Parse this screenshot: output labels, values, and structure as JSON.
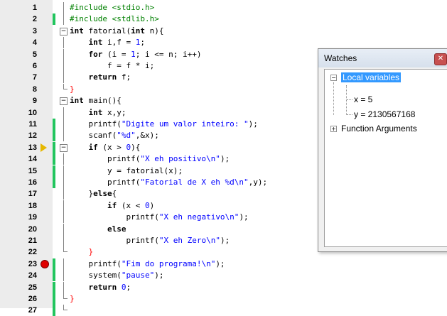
{
  "editor": {
    "lines": [
      {
        "no": "1",
        "tokens": [
          {
            "t": "#include <stdio.h>",
            "c": "pp"
          }
        ]
      },
      {
        "no": "2",
        "tokens": [
          {
            "t": "#include <stdlib.h>",
            "c": "pp"
          }
        ]
      },
      {
        "no": "3",
        "tokens": [
          {
            "t": "int",
            "c": "kw"
          },
          {
            "t": " fatorial(",
            "c": ""
          },
          {
            "t": "int",
            "c": "kw"
          },
          {
            "t": " n){",
            "c": ""
          }
        ]
      },
      {
        "no": "4",
        "tokens": [
          {
            "t": "    ",
            "c": ""
          },
          {
            "t": "int",
            "c": "kw"
          },
          {
            "t": " i,f = ",
            "c": ""
          },
          {
            "t": "1",
            "c": "num"
          },
          {
            "t": ";",
            "c": ""
          }
        ]
      },
      {
        "no": "5",
        "tokens": [
          {
            "t": "    ",
            "c": ""
          },
          {
            "t": "for",
            "c": "kw"
          },
          {
            "t": " (i = ",
            "c": ""
          },
          {
            "t": "1",
            "c": "num"
          },
          {
            "t": "; i <= n; i++)",
            "c": ""
          }
        ]
      },
      {
        "no": "6",
        "tokens": [
          {
            "t": "        f = f * i;",
            "c": ""
          }
        ]
      },
      {
        "no": "7",
        "tokens": [
          {
            "t": "    ",
            "c": ""
          },
          {
            "t": "return",
            "c": "kw"
          },
          {
            "t": " f;",
            "c": ""
          }
        ]
      },
      {
        "no": "8",
        "tokens": [
          {
            "t": "}",
            "c": "sym"
          }
        ]
      },
      {
        "no": "9",
        "tokens": [
          {
            "t": "int",
            "c": "kw"
          },
          {
            "t": " main(){",
            "c": ""
          }
        ]
      },
      {
        "no": "10",
        "tokens": [
          {
            "t": "    ",
            "c": ""
          },
          {
            "t": "int",
            "c": "kw"
          },
          {
            "t": " x,y;",
            "c": ""
          }
        ]
      },
      {
        "no": "11",
        "tokens": [
          {
            "t": "    printf(",
            "c": ""
          },
          {
            "t": "\"Digite um valor inteiro: \"",
            "c": "str"
          },
          {
            "t": ");",
            "c": ""
          }
        ]
      },
      {
        "no": "12",
        "tokens": [
          {
            "t": "    scanf(",
            "c": ""
          },
          {
            "t": "\"%d\"",
            "c": "str"
          },
          {
            "t": ",&x);",
            "c": ""
          }
        ]
      },
      {
        "no": "13",
        "tokens": [
          {
            "t": "    ",
            "c": ""
          },
          {
            "t": "if",
            "c": "kw"
          },
          {
            "t": " (x > ",
            "c": ""
          },
          {
            "t": "0",
            "c": "num"
          },
          {
            "t": "){",
            "c": ""
          }
        ]
      },
      {
        "no": "14",
        "tokens": [
          {
            "t": "        printf(",
            "c": ""
          },
          {
            "t": "\"X eh positivo\\n\"",
            "c": "str"
          },
          {
            "t": ");",
            "c": ""
          }
        ]
      },
      {
        "no": "15",
        "tokens": [
          {
            "t": "        y = fatorial(x);",
            "c": ""
          }
        ]
      },
      {
        "no": "16",
        "tokens": [
          {
            "t": "        printf(",
            "c": ""
          },
          {
            "t": "\"Fatorial de X eh %d\\n\"",
            "c": "str"
          },
          {
            "t": ",y);",
            "c": ""
          }
        ]
      },
      {
        "no": "17",
        "tokens": [
          {
            "t": "    }",
            "c": ""
          },
          {
            "t": "else",
            "c": "kw"
          },
          {
            "t": "{",
            "c": ""
          }
        ]
      },
      {
        "no": "18",
        "tokens": [
          {
            "t": "        ",
            "c": ""
          },
          {
            "t": "if",
            "c": "kw"
          },
          {
            "t": " (x < ",
            "c": ""
          },
          {
            "t": "0",
            "c": "num"
          },
          {
            "t": ")",
            "c": ""
          }
        ]
      },
      {
        "no": "19",
        "tokens": [
          {
            "t": "            printf(",
            "c": ""
          },
          {
            "t": "\"X eh negativo\\n\"",
            "c": "str"
          },
          {
            "t": ");",
            "c": ""
          }
        ]
      },
      {
        "no": "20",
        "tokens": [
          {
            "t": "        ",
            "c": ""
          },
          {
            "t": "else",
            "c": "kw"
          }
        ]
      },
      {
        "no": "21",
        "tokens": [
          {
            "t": "            printf(",
            "c": ""
          },
          {
            "t": "\"X eh Zero\\n\"",
            "c": "str"
          },
          {
            "t": ");",
            "c": ""
          }
        ]
      },
      {
        "no": "22",
        "tokens": [
          {
            "t": "    }",
            "c": "sym"
          }
        ]
      },
      {
        "no": "23",
        "tokens": [
          {
            "t": "    printf(",
            "c": ""
          },
          {
            "t": "\"Fim do programa!\\n\"",
            "c": "str"
          },
          {
            "t": ");",
            "c": ""
          }
        ]
      },
      {
        "no": "24",
        "tokens": [
          {
            "t": "    system(",
            "c": ""
          },
          {
            "t": "\"pause\"",
            "c": "str"
          },
          {
            "t": ");",
            "c": ""
          }
        ]
      },
      {
        "no": "25",
        "tokens": [
          {
            "t": "    ",
            "c": ""
          },
          {
            "t": "return",
            "c": "kw"
          },
          {
            "t": " ",
            "c": ""
          },
          {
            "t": "0",
            "c": "num"
          },
          {
            "t": ";",
            "c": ""
          }
        ]
      },
      {
        "no": "26",
        "tokens": [
          {
            "t": "}",
            "c": "sym"
          }
        ]
      },
      {
        "no": "27",
        "tokens": []
      }
    ],
    "breakpoint_line": "23",
    "exec_line": "13",
    "change_bar_lines": [
      "2",
      "11",
      "12",
      "13",
      "14",
      "15",
      "16",
      "23",
      "24",
      "25",
      "26",
      "27"
    ],
    "fold_open_lines": [
      "3",
      "9",
      "13"
    ],
    "fold_end_lines": [
      "8",
      "22",
      "26",
      "27"
    ],
    "marker_icons": {
      "breakpoint": "breakpoint-icon",
      "execution": "execution-arrow-icon"
    }
  },
  "watches": {
    "title": "Watches",
    "close_icon": "close-icon",
    "local_variables_label": "Local variables",
    "variables": [
      {
        "label": "x = 5"
      },
      {
        "label": "y = 2130567168"
      }
    ],
    "function_arguments_label": "Function Arguments",
    "expanded_symbol": "−",
    "collapsed_symbol": "+"
  },
  "colors": {
    "preprocessor": "#008000",
    "string": "#0000ff",
    "number": "#0000ff",
    "brace": "#ff0000",
    "change_bar": "#22c55e",
    "breakpoint": "#e00000",
    "exec_arrow": "#e6b800",
    "selection": "#3399ff"
  }
}
